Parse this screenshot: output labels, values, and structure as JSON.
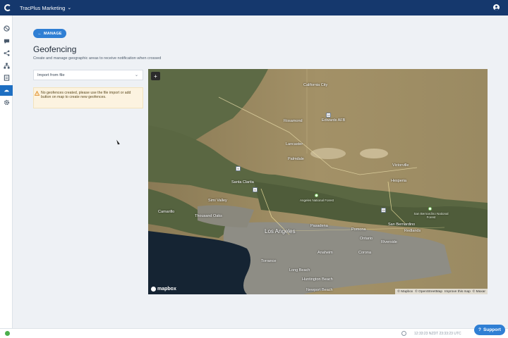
{
  "header": {
    "org_name": "TracPlus Marketing",
    "logo_icon": "tracplus-logo-icon",
    "user_icon": "account-circle-icon"
  },
  "sidebar": {
    "items": [
      {
        "icon": "globe-icon"
      },
      {
        "icon": "chat-icon"
      },
      {
        "icon": "share-icon"
      },
      {
        "icon": "hierarchy-icon"
      },
      {
        "icon": "report-icon"
      },
      {
        "icon": "geofence-icon",
        "active": true
      },
      {
        "icon": "gear-icon"
      }
    ]
  },
  "main": {
    "manage_label": "MANAGE",
    "title": "Geofencing",
    "subtitle": "Create and manage geographic areas to receive notification when crossed",
    "import_select": "Import from file",
    "warning": "No geofences created, please use the file import or add button on map to create new geofences."
  },
  "map": {
    "zoom_in": "+",
    "brand": "mapbox",
    "attribution": [
      "© Mapbox",
      "© OpenStreetMap",
      "Improve this map",
      "© Maxar"
    ],
    "cities": {
      "los_angeles": "Los Angeles",
      "santa_clarita": "Santa Clarita",
      "thousand_oaks": "Thousand Oaks",
      "lancaster": "Lancaster",
      "palmdale": "Palmdale",
      "victorville": "Victorville",
      "hesperia": "Hesperia",
      "san_bernardino": "San Bernardino",
      "riverside": "Riverside",
      "ontario": "Ontario",
      "redlands": "Redlands",
      "long_beach": "Long Beach",
      "huntington_beach": "Huntington Beach",
      "newport_beach": "Newport Beach",
      "camarillo": "Camarillo",
      "california_city": "California City",
      "rosamond": "Rosamond",
      "edwards_afb": "Edwards AFB",
      "torrance": "Torrance",
      "anaheim": "Anaheim",
      "corona": "Corona",
      "pomona": "Pomona",
      "pasadena": "Pasadena",
      "simi_valley": "Simi Valley"
    },
    "forests": {
      "angeles": "Angeles National Forest",
      "san_bernardino": "San Bernardino National Forest"
    }
  },
  "footer": {
    "timestamp": "12:33:23 NZDT 23:33:23 UTC",
    "support_label": "Support"
  }
}
